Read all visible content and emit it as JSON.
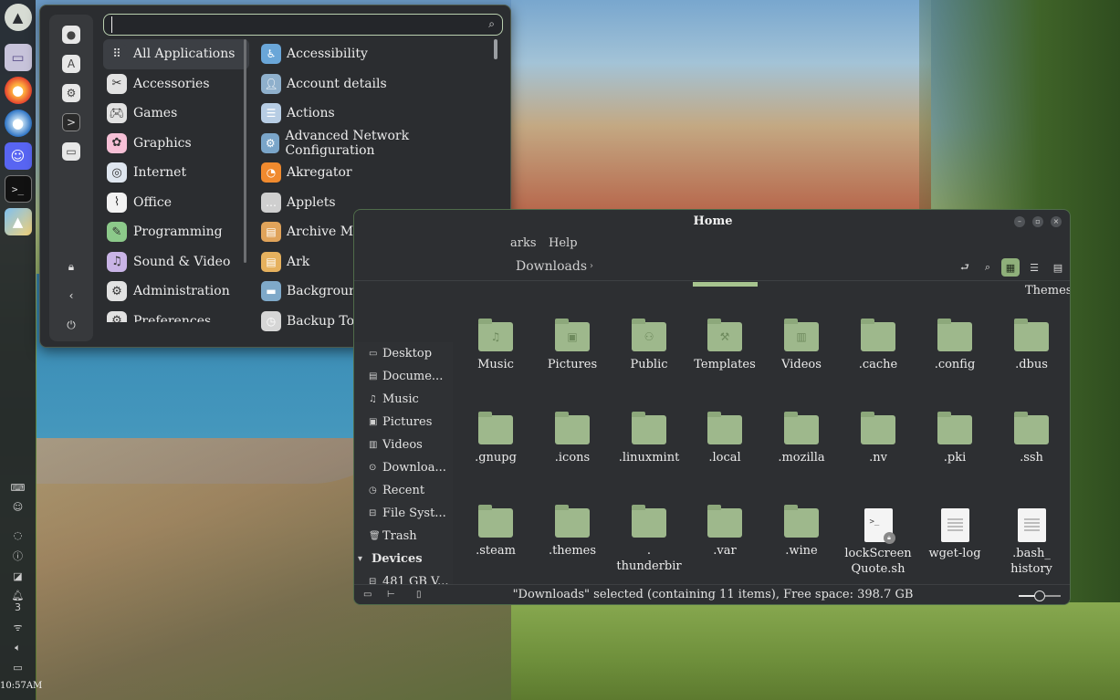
{
  "panel": {
    "clock": "10:57AM",
    "notifications_count": "3",
    "apps": [
      {
        "name": "mint-menu",
        "icon": "mountain-icon"
      },
      {
        "name": "files",
        "icon": "folder-icon"
      },
      {
        "name": "firefox",
        "icon": "firefox-icon"
      },
      {
        "name": "thunderbird",
        "icon": "thunderbird-icon"
      },
      {
        "name": "discord",
        "icon": "discord-icon"
      },
      {
        "name": "terminal",
        "icon": "terminal-icon"
      },
      {
        "name": "image-viewer",
        "icon": "image-icon"
      }
    ]
  },
  "menu": {
    "search": {
      "value": "",
      "placeholder": ""
    },
    "categories": [
      {
        "label": "All Applications",
        "icon": "grid-icon",
        "color": "#3c3f44"
      },
      {
        "label": "Accessories",
        "icon": "accessories-icon",
        "color": "#e2e2e2"
      },
      {
        "label": "Games",
        "icon": "gamepad-icon",
        "color": "#e2e2e2"
      },
      {
        "label": "Graphics",
        "icon": "graphics-icon",
        "color": "#f6c0d6"
      },
      {
        "label": "Internet",
        "icon": "globe-icon",
        "color": "#dfe6ef"
      },
      {
        "label": "Office",
        "icon": "paperclip-icon",
        "color": "#f2f2f2"
      },
      {
        "label": "Programming",
        "icon": "code-icon",
        "color": "#8cc98a"
      },
      {
        "label": "Sound & Video",
        "icon": "music-icon",
        "color": "#c9b4e6"
      },
      {
        "label": "Administration",
        "icon": "admin-icon",
        "color": "#e2e2e2"
      },
      {
        "label": "Preferences",
        "icon": "preferences-icon",
        "color": "#e2e2e2"
      }
    ],
    "apps": [
      {
        "label": "Accessibility",
        "icon": "accessibility-icon",
        "color": "#6aa6d8"
      },
      {
        "label": "Account details",
        "icon": "account-icon",
        "color": "#8fb0cc"
      },
      {
        "label": "Actions",
        "icon": "actions-icon",
        "color": "#b7cde4"
      },
      {
        "label": "Advanced Network Configuration",
        "icon": "network-icon",
        "color": "#7aa5c9"
      },
      {
        "label": "Akregator",
        "icon": "rss-icon",
        "color": "#f08a2e"
      },
      {
        "label": "Applets",
        "icon": "applets-icon",
        "color": "#cfcfcf"
      },
      {
        "label": "Archive Manager",
        "icon": "archive-icon",
        "color": "#e0a35a"
      },
      {
        "label": "Ark",
        "icon": "ark-icon",
        "color": "#e6b15e"
      },
      {
        "label": "Backgrounds",
        "icon": "backgrounds-icon",
        "color": "#7fa9c9"
      },
      {
        "label": "Backup Tool",
        "icon": "backup-icon",
        "color": "#d6d6d6"
      }
    ]
  },
  "filemanager": {
    "title": "Home",
    "menubar": {
      "bookmarks": "arks",
      "help": "Help"
    },
    "breadcrumb": "Downloads",
    "places": [
      {
        "label": "Desktop",
        "icon": "desktop-icon"
      },
      {
        "label": "Docume...",
        "icon": "documents-icon"
      },
      {
        "label": "Music",
        "icon": "music-icon"
      },
      {
        "label": "Pictures",
        "icon": "pictures-icon"
      },
      {
        "label": "Videos",
        "icon": "videos-icon"
      },
      {
        "label": "Downloa...",
        "icon": "downloads-icon"
      },
      {
        "label": "Recent",
        "icon": "recent-icon"
      },
      {
        "label": "File Syst...",
        "icon": "drive-icon"
      },
      {
        "label": "Trash",
        "icon": "trash-icon"
      }
    ],
    "devices_header": "Devices",
    "devices": [
      {
        "label": "481 GB V...",
        "icon": "drive-icon"
      }
    ],
    "partial_top_label": "Themes",
    "files": [
      {
        "label": "Music",
        "kind": "folder",
        "icon": "music-icon"
      },
      {
        "label": "Pictures",
        "kind": "folder",
        "icon": "pictures-icon"
      },
      {
        "label": "Public",
        "kind": "folder",
        "icon": "people-icon"
      },
      {
        "label": "Templates",
        "kind": "folder",
        "icon": "templates-icon"
      },
      {
        "label": "Videos",
        "kind": "folder",
        "icon": "film-icon"
      },
      {
        "label": ".cache",
        "kind": "folder",
        "icon": ""
      },
      {
        "label": ".config",
        "kind": "folder",
        "icon": ""
      },
      {
        "label": ".dbus",
        "kind": "folder",
        "icon": ""
      },
      {
        "label": ".gnupg",
        "kind": "folder",
        "icon": ""
      },
      {
        "label": ".icons",
        "kind": "folder",
        "icon": ""
      },
      {
        "label": ".linuxmint",
        "kind": "folder",
        "icon": ""
      },
      {
        "label": ".local",
        "kind": "folder",
        "icon": ""
      },
      {
        "label": ".mozilla",
        "kind": "folder",
        "icon": ""
      },
      {
        "label": ".nv",
        "kind": "folder",
        "icon": ""
      },
      {
        "label": ".pki",
        "kind": "folder",
        "icon": ""
      },
      {
        "label": ".ssh",
        "kind": "folder",
        "icon": ""
      },
      {
        "label": ".steam",
        "kind": "folder",
        "icon": ""
      },
      {
        "label": ".themes",
        "kind": "folder",
        "icon": ""
      },
      {
        "label": ".\nthunderbir",
        "kind": "folder",
        "icon": ""
      },
      {
        "label": ".var",
        "kind": "folder",
        "icon": ""
      },
      {
        "label": ".wine",
        "kind": "folder",
        "icon": ""
      },
      {
        "label": "lockScreen\nQuote.sh",
        "kind": "script",
        "icon": "script-icon"
      },
      {
        "label": "wget-log",
        "kind": "text",
        "icon": "text-file-icon"
      },
      {
        "label": ".bash_\nhistory",
        "kind": "text",
        "icon": "text-file-icon"
      }
    ],
    "status": "\"Downloads\" selected (containing 11 items), Free space: 398.7 GB",
    "zoom_level": 0.5
  }
}
